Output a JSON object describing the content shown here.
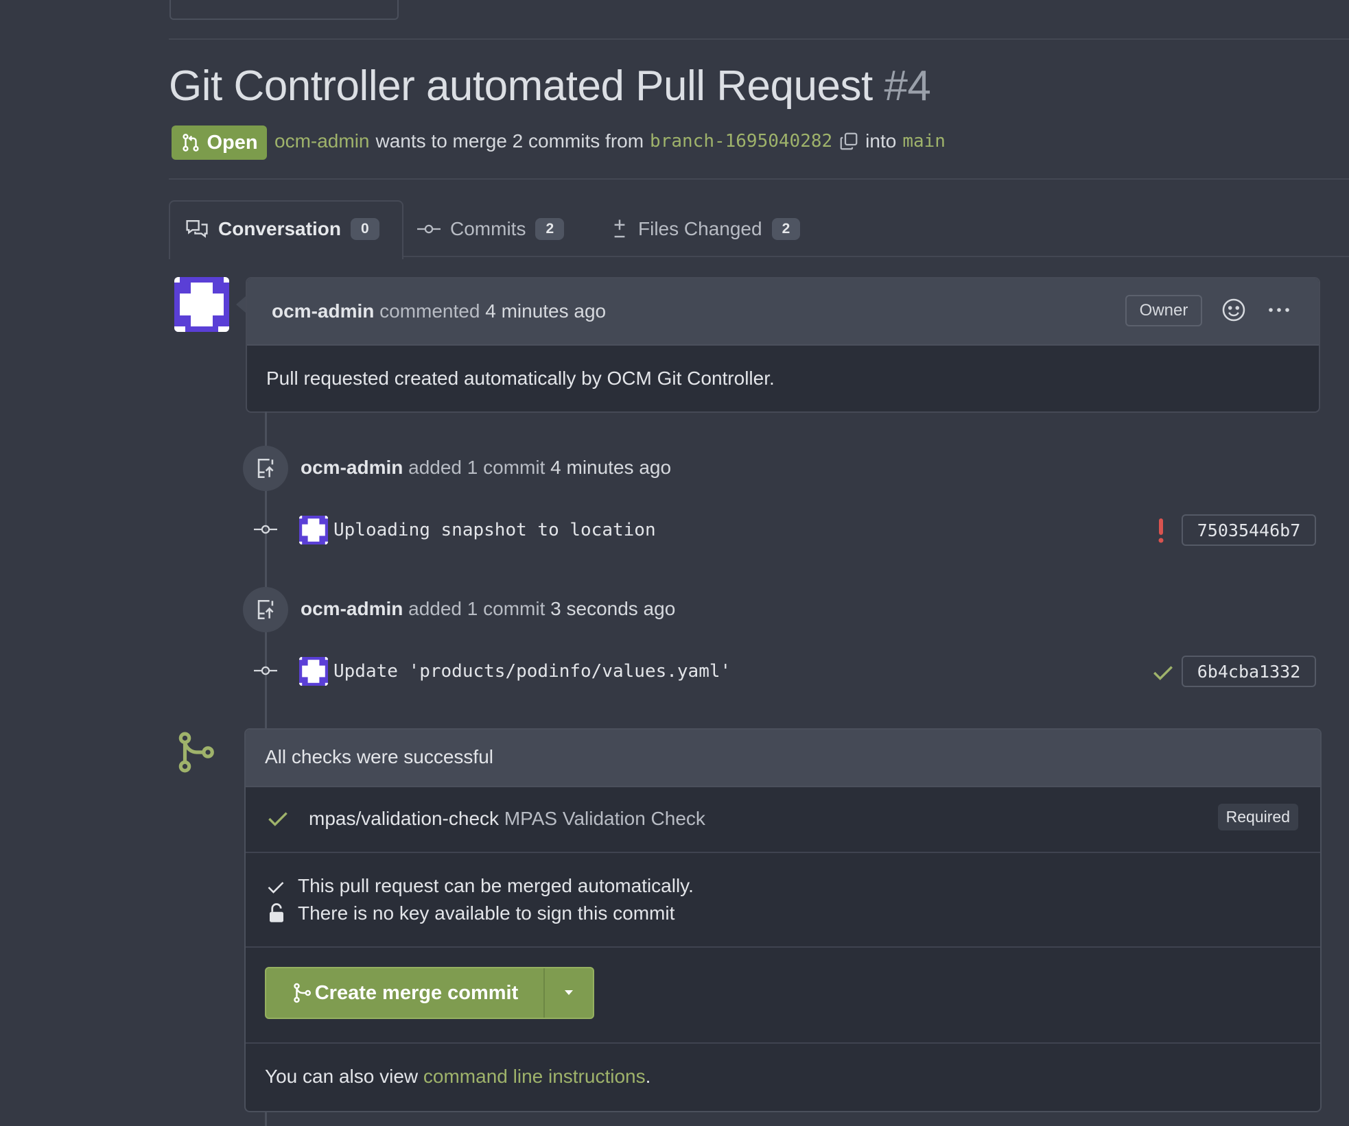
{
  "pr": {
    "title": "Git Controller automated Pull Request",
    "number": "#4",
    "status": "Open",
    "author": "ocm-admin",
    "merge_text": "wants to merge 2 commits from",
    "source_branch": "branch-1695040282",
    "into_text": "into",
    "target_branch": "main"
  },
  "tabs": [
    {
      "label": "Conversation",
      "count": "0",
      "icon": "comment-discussion-icon"
    },
    {
      "label": "Commits",
      "count": "2",
      "icon": "git-commit-icon"
    },
    {
      "label": "Files Changed",
      "count": "2",
      "icon": "diff-icon"
    }
  ],
  "comment": {
    "author": "ocm-admin",
    "action": "commented",
    "time": "4 minutes ago",
    "badge": "Owner",
    "body": "Pull requested created automatically by OCM Git Controller."
  },
  "timeline": [
    {
      "author": "ocm-admin",
      "action": "added 1 commit",
      "time": "4 minutes ago",
      "commit_message": "Uploading snapshot to location",
      "commit_status": "failure",
      "sha": "75035446b7"
    },
    {
      "author": "ocm-admin",
      "action": "added 1 commit",
      "time": "3 seconds ago",
      "commit_message": "Update 'products/podinfo/values.yaml'",
      "commit_status": "success",
      "sha": "6b4cba1332"
    }
  ],
  "merge": {
    "checks_header": "All checks were successful",
    "check_name": "mpas/validation-check",
    "check_desc": "MPAS Validation Check",
    "check_badge": "Required",
    "mergeable_text": "This pull request can be merged automatically.",
    "signing_text": "There is no key available to sign this commit",
    "button_label": "Create merge commit",
    "footer_prefix": "You can also view",
    "footer_link": "command line instructions",
    "footer_suffix": "."
  },
  "colors": {
    "accent_green": "#7c9c4c",
    "link_green": "#9fb36b",
    "error_red": "#d9534f",
    "background": "#353944"
  }
}
